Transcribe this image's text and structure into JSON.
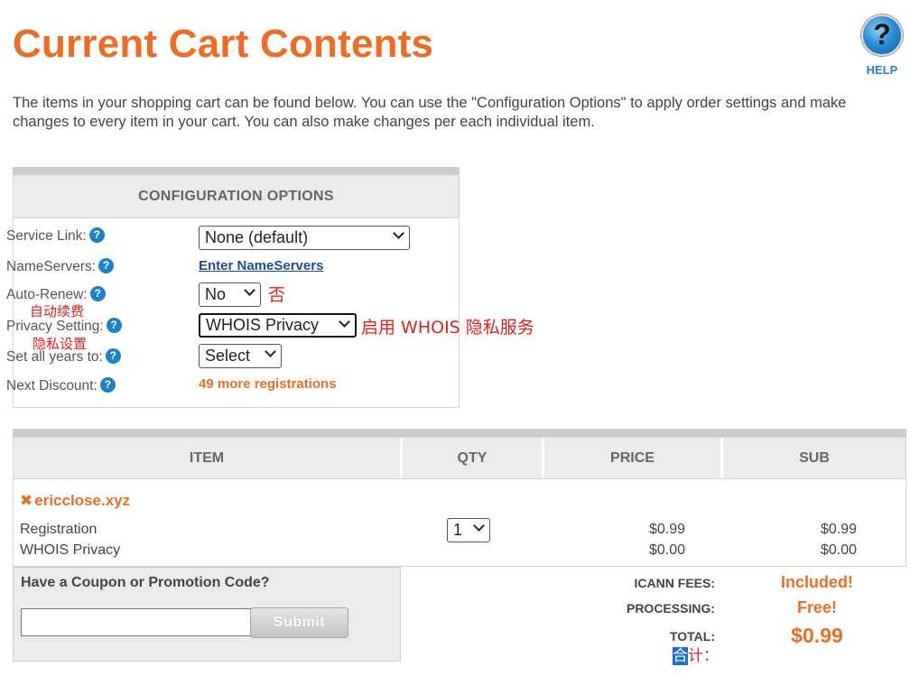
{
  "page": {
    "title": "Current Cart Contents",
    "help_label": "HELP",
    "help_glyph": "?",
    "intro": "The items in your shopping cart can be found below. You can use the \"Configuration Options\" to apply order settings and make changes to every item in your cart. You can also make changes per each individual item."
  },
  "config": {
    "header": "CONFIGURATION OPTIONS",
    "service_link": {
      "label": "Service Link:",
      "value": "None (default)"
    },
    "nameservers": {
      "label": "NameServers:",
      "link": "Enter NameServers"
    },
    "auto_renew": {
      "label": "Auto-Renew:",
      "value": "No",
      "annotation": "否",
      "note": "自动续费"
    },
    "privacy": {
      "label": "Privacy Setting:",
      "value": "WHOIS Privacy",
      "annotation": "启用 WHOIS 隐私服务",
      "note": "隐私设置"
    },
    "years": {
      "label": "Set all years to:",
      "value": "Select"
    },
    "discount": {
      "label": "Next Discount:",
      "value": "49 more registrations"
    }
  },
  "items_table": {
    "headers": [
      "ITEM",
      "QTY",
      "PRICE",
      "SUB"
    ],
    "domain": "ericclose.xyz",
    "remove_glyph": "✖",
    "qty": "1",
    "rows": [
      {
        "name": "Registration",
        "price": "$0.99",
        "sub": "$0.99"
      },
      {
        "name": "WHOIS Privacy",
        "price": "$0.00",
        "sub": "$0.00"
      }
    ]
  },
  "coupon": {
    "title": "Have a Coupon or Promotion Code?",
    "input_value": "",
    "submit_label": "Submit"
  },
  "totals": {
    "icann_label": "ICANN FEES:",
    "icann_value": "Included!",
    "processing_label": "PROCESSING:",
    "processing_value": "Free!",
    "total_label": "TOTAL:",
    "total_value": "$0.99",
    "annotation_highlight": "合",
    "annotation_rest": "计："
  },
  "colors": {
    "accent": "#f06c22",
    "link": "#1a4f8a",
    "help_blue": "#1d7fd0",
    "annotation_red": "#e02020",
    "header_gray": "#ebebeb"
  }
}
